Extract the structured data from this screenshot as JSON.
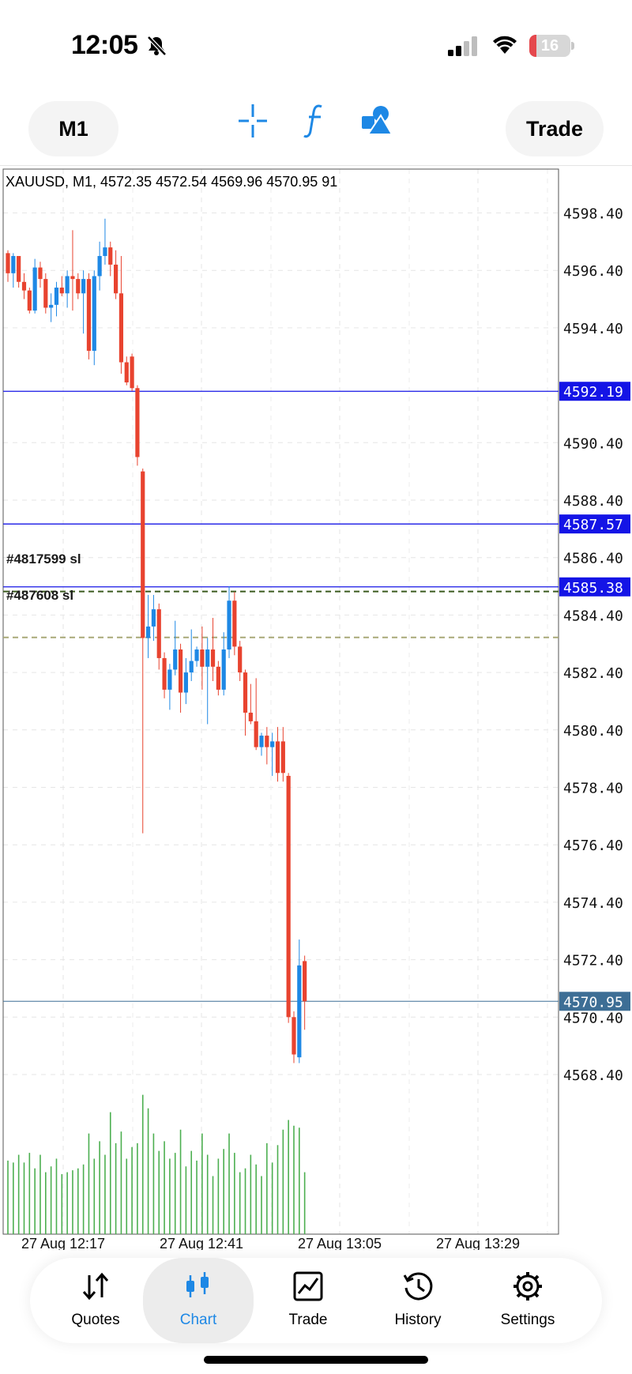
{
  "status_bar": {
    "time": "12:05",
    "battery": "16"
  },
  "toolbar": {
    "timeframe": "M1",
    "trade": "Trade"
  },
  "chart": {
    "header": "XAUUSD, M1, 4572.35 4572.54 4569.96 4570.95 91",
    "price_labels": [
      "4598.40",
      "4596.40",
      "4594.40",
      "4590.40",
      "4588.40",
      "4586.40",
      "4584.40",
      "4582.40",
      "4580.40",
      "4578.40",
      "4576.40",
      "4574.40",
      "4572.40",
      "4570.40",
      "4568.40"
    ],
    "tags": [
      "#4817599 sl",
      "#487608 sl"
    ],
    "level_lines": [
      {
        "price": "4592.19",
        "color": "#1414e6"
      },
      {
        "price": "4587.57",
        "color": "#1414e6"
      },
      {
        "price": "4585.38",
        "color": "#1414e6"
      },
      {
        "price": "4570.95",
        "color": "#3d6e95"
      }
    ],
    "time_labels": [
      "27 Aug 12:17",
      "27 Aug 12:41",
      "27 Aug 13:05",
      "27 Aug 13:29"
    ],
    "colors": {
      "bull": "#1e88e5",
      "bear": "#e8432f",
      "volume": "#4caf50",
      "level": "#1414e6",
      "bid": "#3d6e95"
    }
  },
  "chart_data": {
    "type": "candlestick",
    "symbol": "XAUUSD",
    "timeframe": "M1",
    "ylim": [
      4567.4,
      4599.6
    ],
    "candles": [
      {
        "o": 4597.0,
        "h": 4597.1,
        "l": 4596.0,
        "c": 4596.3
      },
      {
        "o": 4596.3,
        "h": 4597.0,
        "l": 4595.8,
        "c": 4596.9
      },
      {
        "o": 4596.9,
        "h": 4596.9,
        "l": 4595.8,
        "c": 4596.0
      },
      {
        "o": 4596.0,
        "h": 4596.3,
        "l": 4595.4,
        "c": 4595.7
      },
      {
        "o": 4595.7,
        "h": 4595.8,
        "l": 4594.9,
        "c": 4595.0
      },
      {
        "o": 4595.0,
        "h": 4596.8,
        "l": 4594.9,
        "c": 4596.5
      },
      {
        "o": 4596.5,
        "h": 4596.7,
        "l": 4595.8,
        "c": 4596.1
      },
      {
        "o": 4596.1,
        "h": 4596.3,
        "l": 4594.9,
        "c": 4595.1
      },
      {
        "o": 4595.1,
        "h": 4595.6,
        "l": 4594.6,
        "c": 4595.2
      },
      {
        "o": 4595.2,
        "h": 4596.0,
        "l": 4594.8,
        "c": 4595.8
      },
      {
        "o": 4595.8,
        "h": 4596.2,
        "l": 4595.5,
        "c": 4595.6
      },
      {
        "o": 4595.6,
        "h": 4596.4,
        "l": 4595.1,
        "c": 4596.2
      },
      {
        "o": 4596.2,
        "h": 4597.8,
        "l": 4595.0,
        "c": 4596.1
      },
      {
        "o": 4596.1,
        "h": 4596.3,
        "l": 4595.4,
        "c": 4595.6
      },
      {
        "o": 4595.6,
        "h": 4596.4,
        "l": 4594.2,
        "c": 4596.1
      },
      {
        "o": 4596.1,
        "h": 4596.3,
        "l": 4593.3,
        "c": 4593.6
      },
      {
        "o": 4593.6,
        "h": 4596.4,
        "l": 4593.1,
        "c": 4596.2
      },
      {
        "o": 4596.2,
        "h": 4597.4,
        "l": 4595.7,
        "c": 4596.9
      },
      {
        "o": 4596.9,
        "h": 4598.2,
        "l": 4596.6,
        "c": 4597.2
      },
      {
        "o": 4597.2,
        "h": 4597.4,
        "l": 4596.2,
        "c": 4596.6
      },
      {
        "o": 4596.6,
        "h": 4597.1,
        "l": 4595.4,
        "c": 4595.6
      },
      {
        "o": 4595.6,
        "h": 4596.9,
        "l": 4592.8,
        "c": 4593.2
      },
      {
        "o": 4593.2,
        "h": 4593.4,
        "l": 4592.4,
        "c": 4592.5
      },
      {
        "o": 4593.4,
        "h": 4593.5,
        "l": 4592.2,
        "c": 4592.3
      },
      {
        "o": 4592.3,
        "h": 4592.4,
        "l": 4589.6,
        "c": 4589.9
      },
      {
        "o": 4589.4,
        "h": 4589.5,
        "l": 4576.8,
        "c": 4583.6
      },
      {
        "o": 4583.6,
        "h": 4585.1,
        "l": 4582.9,
        "c": 4584.0
      },
      {
        "o": 4584.0,
        "h": 4585.1,
        "l": 4583.5,
        "c": 4584.6
      },
      {
        "o": 4584.6,
        "h": 4584.8,
        "l": 4582.5,
        "c": 4582.9
      },
      {
        "o": 4582.9,
        "h": 4583.1,
        "l": 4581.5,
        "c": 4581.8
      },
      {
        "o": 4581.8,
        "h": 4582.7,
        "l": 4581.1,
        "c": 4582.5
      },
      {
        "o": 4582.5,
        "h": 4584.2,
        "l": 4582.3,
        "c": 4583.2
      },
      {
        "o": 4583.2,
        "h": 4583.4,
        "l": 4581.0,
        "c": 4581.7
      },
      {
        "o": 4581.7,
        "h": 4582.9,
        "l": 4581.3,
        "c": 4582.4
      },
      {
        "o": 4582.4,
        "h": 4583.9,
        "l": 4582.1,
        "c": 4582.8
      },
      {
        "o": 4582.8,
        "h": 4583.3,
        "l": 4582.6,
        "c": 4583.2
      },
      {
        "o": 4583.2,
        "h": 4584.0,
        "l": 4581.8,
        "c": 4582.6
      },
      {
        "o": 4582.6,
        "h": 4583.6,
        "l": 4580.6,
        "c": 4583.2
      },
      {
        "o": 4583.2,
        "h": 4584.3,
        "l": 4582.1,
        "c": 4582.6
      },
      {
        "o": 4582.6,
        "h": 4582.8,
        "l": 4581.6,
        "c": 4581.8
      },
      {
        "o": 4581.8,
        "h": 4583.8,
        "l": 4581.6,
        "c": 4583.2
      },
      {
        "o": 4583.2,
        "h": 4585.4,
        "l": 4582.9,
        "c": 4584.9
      },
      {
        "o": 4584.9,
        "h": 4585.2,
        "l": 4583.0,
        "c": 4583.3
      },
      {
        "o": 4583.3,
        "h": 4583.5,
        "l": 4582.1,
        "c": 4582.4
      },
      {
        "o": 4582.4,
        "h": 4582.5,
        "l": 4580.2,
        "c": 4581.0
      },
      {
        "o": 4581.0,
        "h": 4582.0,
        "l": 4580.6,
        "c": 4580.7
      },
      {
        "o": 4580.7,
        "h": 4582.2,
        "l": 4579.7,
        "c": 4579.8
      },
      {
        "o": 4579.8,
        "h": 4580.3,
        "l": 4579.5,
        "c": 4580.2
      },
      {
        "o": 4580.2,
        "h": 4580.5,
        "l": 4579.2,
        "c": 4579.8
      },
      {
        "o": 4579.8,
        "h": 4580.3,
        "l": 4578.8,
        "c": 4580.0
      },
      {
        "o": 4580.0,
        "h": 4580.5,
        "l": 4578.6,
        "c": 4578.9
      },
      {
        "o": 4580.0,
        "h": 4580.5,
        "l": 4578.6,
        "c": 4578.9
      },
      {
        "o": 4578.8,
        "h": 4578.9,
        "l": 4570.2,
        "c": 4570.4
      },
      {
        "o": 4570.4,
        "h": 4570.6,
        "l": 4568.8,
        "c": 4569.1
      },
      {
        "o": 4569.0,
        "h": 4573.1,
        "l": 4568.8,
        "c": 4572.2
      },
      {
        "o": 4572.35,
        "h": 4572.54,
        "l": 4569.96,
        "c": 4570.95
      }
    ],
    "volume": [
      0.38,
      0.37,
      0.41,
      0.37,
      0.42,
      0.34,
      0.41,
      0.32,
      0.35,
      0.39,
      0.31,
      0.32,
      0.33,
      0.34,
      0.36,
      0.52,
      0.39,
      0.48,
      0.41,
      0.63,
      0.47,
      0.53,
      0.39,
      0.45,
      0.47,
      0.72,
      0.65,
      0.52,
      0.43,
      0.48,
      0.39,
      0.42,
      0.54,
      0.35,
      0.43,
      0.38,
      0.52,
      0.41,
      0.3,
      0.39,
      0.44,
      0.52,
      0.42,
      0.32,
      0.34,
      0.41,
      0.36,
      0.3,
      0.47,
      0.37,
      0.46,
      0.54,
      0.59,
      0.56,
      0.55,
      0.32
    ],
    "max_volume_px": 245
  },
  "bottom_nav": {
    "items": [
      {
        "label": "Quotes",
        "icon": "quotes-icon"
      },
      {
        "label": "Chart",
        "icon": "chart-icon"
      },
      {
        "label": "Trade",
        "icon": "trade-icon"
      },
      {
        "label": "History",
        "icon": "history-icon"
      },
      {
        "label": "Settings",
        "icon": "settings-icon"
      }
    ]
  }
}
